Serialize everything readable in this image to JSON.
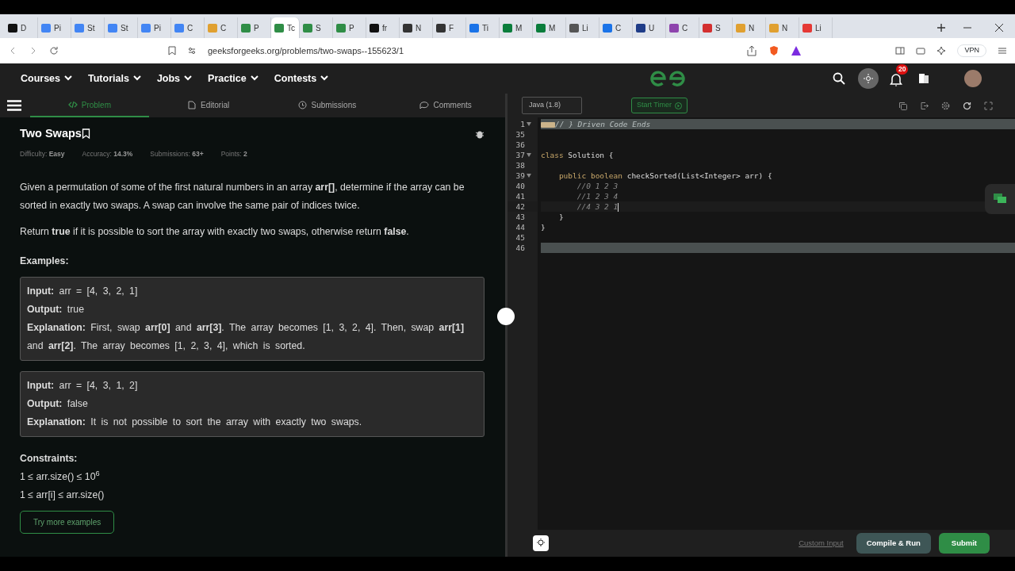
{
  "browser_tabs": [
    {
      "label": "D",
      "color": "#111111",
      "selected": false
    },
    {
      "label": "Pi",
      "color": "#4285f4",
      "selected": false
    },
    {
      "label": "St",
      "color": "#4285f4",
      "selected": false
    },
    {
      "label": "St",
      "color": "#4285f4",
      "selected": false
    },
    {
      "label": "Pi",
      "color": "#4285f4",
      "selected": false
    },
    {
      "label": "C",
      "color": "#4285f4",
      "selected": false
    },
    {
      "label": "C",
      "color": "#e0a030",
      "selected": false
    },
    {
      "label": "P",
      "color": "#2f8d46",
      "selected": false
    },
    {
      "label": "Tc",
      "color": "#2f8d46",
      "selected": true
    },
    {
      "label": "S",
      "color": "#2f8d46",
      "selected": false
    },
    {
      "label": "P",
      "color": "#2f8d46",
      "selected": false
    },
    {
      "label": "fr",
      "color": "#111111",
      "selected": false
    },
    {
      "label": "N",
      "color": "#333333",
      "selected": false
    },
    {
      "label": "F",
      "color": "#333333",
      "selected": false
    },
    {
      "label": "Ti",
      "color": "#1a73e8",
      "selected": false
    },
    {
      "label": "M",
      "color": "#0a7d3b",
      "selected": false
    },
    {
      "label": "M",
      "color": "#0a7d3b",
      "selected": false
    },
    {
      "label": "Li",
      "color": "#555555",
      "selected": false
    },
    {
      "label": "C",
      "color": "#1a73e8",
      "selected": false
    },
    {
      "label": "U",
      "color": "#1f3c88",
      "selected": false
    },
    {
      "label": "C",
      "color": "#8e44ad",
      "selected": false
    },
    {
      "label": "S",
      "color": "#d32f2f",
      "selected": false
    },
    {
      "label": "N",
      "color": "#e0a030",
      "selected": false
    },
    {
      "label": "N",
      "color": "#e0a030",
      "selected": false
    },
    {
      "label": "Li",
      "color": "#e53935",
      "selected": false
    }
  ],
  "address_bar": {
    "url": "geeksforgeeks.org/problems/two-swaps--155623/1",
    "vpn": "VPN"
  },
  "site_nav": {
    "menus": [
      "Courses",
      "Tutorials",
      "Jobs",
      "Practice",
      "Contests"
    ],
    "notification_count": "20"
  },
  "problem_tabs": [
    {
      "label": "Problem",
      "selected": true
    },
    {
      "label": "Editorial",
      "selected": false
    },
    {
      "label": "Submissions",
      "selected": false
    },
    {
      "label": "Comments",
      "selected": false
    }
  ],
  "problem": {
    "title": "Two Swaps",
    "meta": [
      {
        "label": "Difficulty:",
        "value": "Easy"
      },
      {
        "label": "Accuracy:",
        "value": "14.3%"
      },
      {
        "label": "Submissions:",
        "value": "63+"
      },
      {
        "label": "Points:",
        "value": "2"
      }
    ],
    "paragraphs": [
      "Given a permutation of some of the first natural numbers in an array **arr[]**, determine if the array can be sorted in exactly two swaps. A swap can involve the same pair of indices twice.",
      "Return **true** if it is possible to sort the array with exactly two swaps, otherwise return **false**."
    ],
    "examples_heading": "Examples:",
    "examples": [
      [
        "**Input:** arr = [4, 3, 2, 1]",
        "**Output:** true",
        "**Explanation:** First, swap **arr[0]** and **arr[3]**. The array becomes [1, 3, 2, 4]. Then, swap **arr[1]** and **arr[2]**. The array becomes [1, 2, 3, 4], which is sorted."
      ],
      [
        "**Input:** arr = [4, 3, 1, 2]",
        "**Output:** false",
        "**Explanation:** It is not possible to sort the array with exactly two swaps."
      ]
    ],
    "constraints_heading": "Constraints:",
    "constraints": [
      "1 ≤ arr.size() ≤ 10$^{6}$",
      "1 ≤ arr[i] ≤ arr.size()"
    ],
    "more_button": "Try more examples"
  },
  "editor": {
    "language": "Java (1.8)",
    "timer_button": "Start Timer",
    "lines": [
      {
        "num": "1",
        "fold": true,
        "folded": true,
        "highlighted": true,
        "active": false,
        "tokens": [
          {
            "t": "// } Driven Code Ends",
            "kind": "faded"
          }
        ]
      },
      {
        "num": "35",
        "fold": false,
        "folded": false,
        "highlighted": false,
        "active": false
      },
      {
        "num": "36",
        "fold": false,
        "folded": false,
        "highlighted": false,
        "active": false
      },
      {
        "num": "37",
        "fold": true,
        "folded": false,
        "highlighted": false,
        "active": false,
        "tokens": [
          {
            "t": "class",
            "kind": "keyword"
          },
          {
            "t": " Solution {",
            "kind": "plain"
          }
        ]
      },
      {
        "num": "38",
        "fold": false,
        "folded": false,
        "highlighted": false,
        "active": false
      },
      {
        "num": "39",
        "fold": true,
        "folded": false,
        "highlighted": false,
        "active": false,
        "tokens": [
          {
            "t": "    public boolean",
            "kind": "keyword"
          },
          {
            "t": " checkSorted(List<Integer> arr) {",
            "kind": "plain"
          }
        ]
      },
      {
        "num": "40",
        "fold": false,
        "folded": false,
        "highlighted": false,
        "active": false,
        "tokens": [
          {
            "t": "        //0 1 2 3",
            "kind": "comment"
          }
        ]
      },
      {
        "num": "41",
        "fold": false,
        "folded": false,
        "highlighted": false,
        "active": false,
        "tokens": [
          {
            "t": "        //1 2 3 4",
            "kind": "comment"
          }
        ]
      },
      {
        "num": "42",
        "fold": false,
        "folded": false,
        "highlighted": false,
        "active": true,
        "tokens": [
          {
            "t": "        //4 3 2 1",
            "kind": "comment"
          }
        ]
      },
      {
        "num": "43",
        "fold": false,
        "folded": false,
        "highlighted": false,
        "active": false,
        "tokens": [
          {
            "t": "    }",
            "kind": "plain"
          }
        ]
      },
      {
        "num": "44",
        "fold": false,
        "folded": false,
        "highlighted": false,
        "active": false,
        "tokens": [
          {
            "t": "}",
            "kind": "plain"
          }
        ]
      },
      {
        "num": "45",
        "fold": false,
        "folded": false,
        "highlighted": false,
        "active": false
      },
      {
        "num": "46",
        "fold": false,
        "folded": false,
        "highlighted": true,
        "active": false
      }
    ],
    "custom_input": "Custom Input",
    "compile_button": "Compile & Run",
    "submit_button": "Submit"
  }
}
